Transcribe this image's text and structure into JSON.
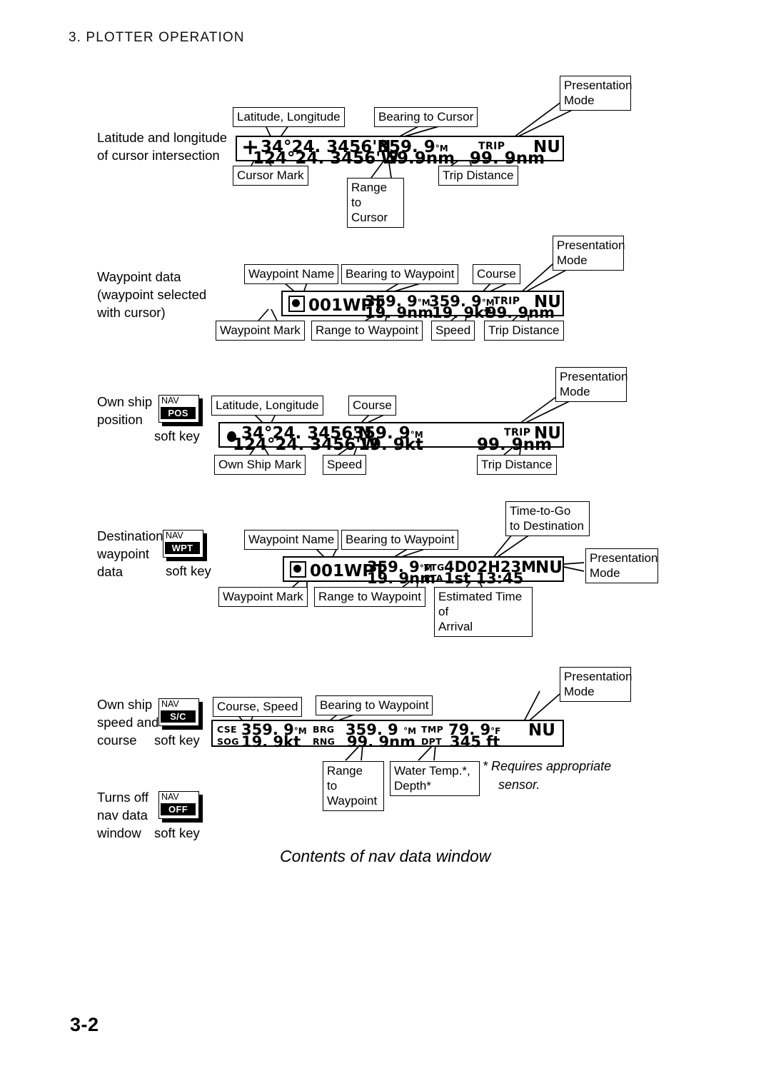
{
  "header": {
    "chapter": "3. PLOTTER OPERATION"
  },
  "footer": {
    "page_number": "3-2"
  },
  "figure_caption": "Contents of nav data window",
  "footnote": {
    "line1": "* Requires appropriate",
    "line2": "sensor."
  },
  "sections": [
    {
      "id": "cursor",
      "side_label_line1": "Latitude and longitude",
      "side_label_line2": "of cursor intersection",
      "callouts": {
        "lat_lon": "Latitude, Longitude",
        "bearing": "Bearing to Cursor",
        "presentation_mode_l1": "Presentation",
        "presentation_mode_l2": "Mode",
        "cursor_mark": "Cursor Mark",
        "range_l1": "Range to",
        "range_l2": "Cursor",
        "trip": "Trip Distance"
      },
      "display": {
        "cursor_glyph": "+",
        "latitude": "34°24. 3456'N",
        "longitude": "124°24. 3456'W",
        "bearing": "359. 9",
        "bearing_unit": "°M",
        "range": "59.9nm",
        "trip_label": "TRIP",
        "trip_value": "99. 9nm",
        "mode": "NU"
      }
    },
    {
      "id": "waypoint",
      "side_label_line1": "Waypoint data",
      "side_label_line2": "(waypoint selected",
      "side_label_line3": "with cursor)",
      "callouts": {
        "wpt_name": "Waypoint Name",
        "bearing": "Bearing to Waypoint",
        "course": "Course",
        "presentation_mode_l1": "Presentation",
        "presentation_mode_l2": "Mode",
        "wpt_mark": "Waypoint Mark",
        "range": "Range to Waypoint",
        "speed": "Speed",
        "trip": "Trip Distance"
      },
      "display": {
        "wpt_name": "001WPT",
        "bearing": "359. 9",
        "bearing_unit": "°M",
        "course": "359. 9",
        "course_unit": "°M",
        "trip_label": "TRIP",
        "mode": "NU",
        "range": "19. 9nm",
        "speed": "19. 9kt",
        "trip_value": "99. 9nm"
      }
    },
    {
      "id": "own-position",
      "side_label_line1": "Own ship",
      "side_label_line2": "position",
      "softkey_word": "soft key",
      "softkey": {
        "top": "NAV",
        "highlight": "POS"
      },
      "callouts": {
        "lat_lon": "Latitude, Longitude",
        "course": "Course",
        "presentation_mode_l1": "Presentation",
        "presentation_mode_l2": "Mode",
        "ship_mark": "Own Ship Mark",
        "speed": "Speed",
        "trip": "Trip Distance"
      },
      "display": {
        "latitude": "34°24. 3456'N",
        "longitude": "124°24. 3456'W",
        "course": "359. 9",
        "course_unit": "°M",
        "speed": "19. 9kt",
        "trip_label": "TRIP",
        "trip_value": "99. 9nm",
        "mode": "NU"
      }
    },
    {
      "id": "destination",
      "side_label_line1": "Destination",
      "side_label_line2": "waypoint",
      "side_label_line3": "data",
      "softkey_word": "soft key",
      "softkey": {
        "top": "NAV",
        "highlight": "WPT"
      },
      "callouts": {
        "wpt_name": "Waypoint Name",
        "bearing": "Bearing to Waypoint",
        "ttg_l1": "Time-to-Go",
        "ttg_l2": "to Destination",
        "presentation_mode_l1": "Presentation",
        "presentation_mode_l2": "Mode",
        "wpt_mark": "Waypoint Mark",
        "range": "Range to Waypoint",
        "eta_l1": "Estimated Time of",
        "eta_l2": "Arrival"
      },
      "display": {
        "wpt_name": "001WPT",
        "bearing": "359. 9",
        "bearing_unit": "°M",
        "ttg_label": "TTG",
        "ttg_value": "4D02H23M",
        "mode": "NU",
        "range": "19. 9nm",
        "eta_label": "ETA",
        "eta_value": "1st 13:45"
      }
    },
    {
      "id": "speed-course",
      "side_label_line1": "Own ship",
      "side_label_line2": "speed and",
      "side_label_line3": "course",
      "softkey_word": "soft key",
      "softkey": {
        "top": "NAV",
        "highlight": "S/C"
      },
      "callouts": {
        "course_speed": "Course, Speed",
        "bearing": "Bearing to Waypoint",
        "presentation_mode_l1": "Presentation",
        "presentation_mode_l2": "Mode",
        "range_l1": "Range",
        "range_l2": "to",
        "range_l3": "Waypoint",
        "temp_l1": "Water Temp.*,",
        "temp_l2": "Depth*"
      },
      "display": {
        "cse_label": "CSE",
        "cse_value": "359. 9",
        "cse_unit": "°M",
        "brg_label": "BRG",
        "brg_value": "359. 9",
        "brg_unit": "°M",
        "tmp_label": "TMP",
        "tmp_value": "79. 9",
        "tmp_unit": "°F",
        "mode": "NU",
        "sog_label": "SOG",
        "sog_value": "19. 9kt",
        "rng_label": "RNG",
        "rng_value": "99. 9nm",
        "dpt_label": "DPT",
        "dpt_value": "345 ft"
      }
    },
    {
      "id": "nav-off",
      "side_label_line1": "Turns off",
      "side_label_line2": "nav data",
      "side_label_line3": "window",
      "softkey_word": "soft key",
      "softkey": {
        "top": "NAV",
        "highlight": "OFF"
      }
    }
  ]
}
